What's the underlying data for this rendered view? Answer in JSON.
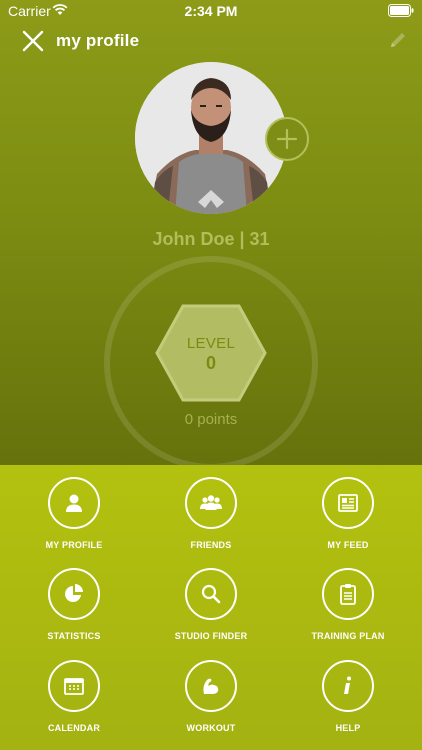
{
  "status_bar": {
    "carrier": "Carrier",
    "time": "2:34 PM"
  },
  "header": {
    "title": "my profile"
  },
  "profile": {
    "name": "John Doe | 31",
    "level_label": "LEVEL",
    "level_value": "0",
    "points": "0 points"
  },
  "menu": {
    "items": [
      {
        "label": "MY PROFILE",
        "icon": "person-icon"
      },
      {
        "label": "FRIENDS",
        "icon": "friends-icon"
      },
      {
        "label": "MY FEED",
        "icon": "newspaper-icon"
      },
      {
        "label": "STATISTICS",
        "icon": "pie-chart-icon"
      },
      {
        "label": "STUDIO FINDER",
        "icon": "search-icon"
      },
      {
        "label": "TRAINING PLAN",
        "icon": "clipboard-icon"
      },
      {
        "label": "CALENDAR",
        "icon": "calendar-icon"
      },
      {
        "label": "WORKOUT",
        "icon": "bicep-icon"
      },
      {
        "label": "HELP",
        "icon": "info-icon"
      }
    ]
  },
  "colors": {
    "accent": "#b3c10f",
    "header_bg": "#7d8d12",
    "name_text": "#b3bd5a"
  }
}
